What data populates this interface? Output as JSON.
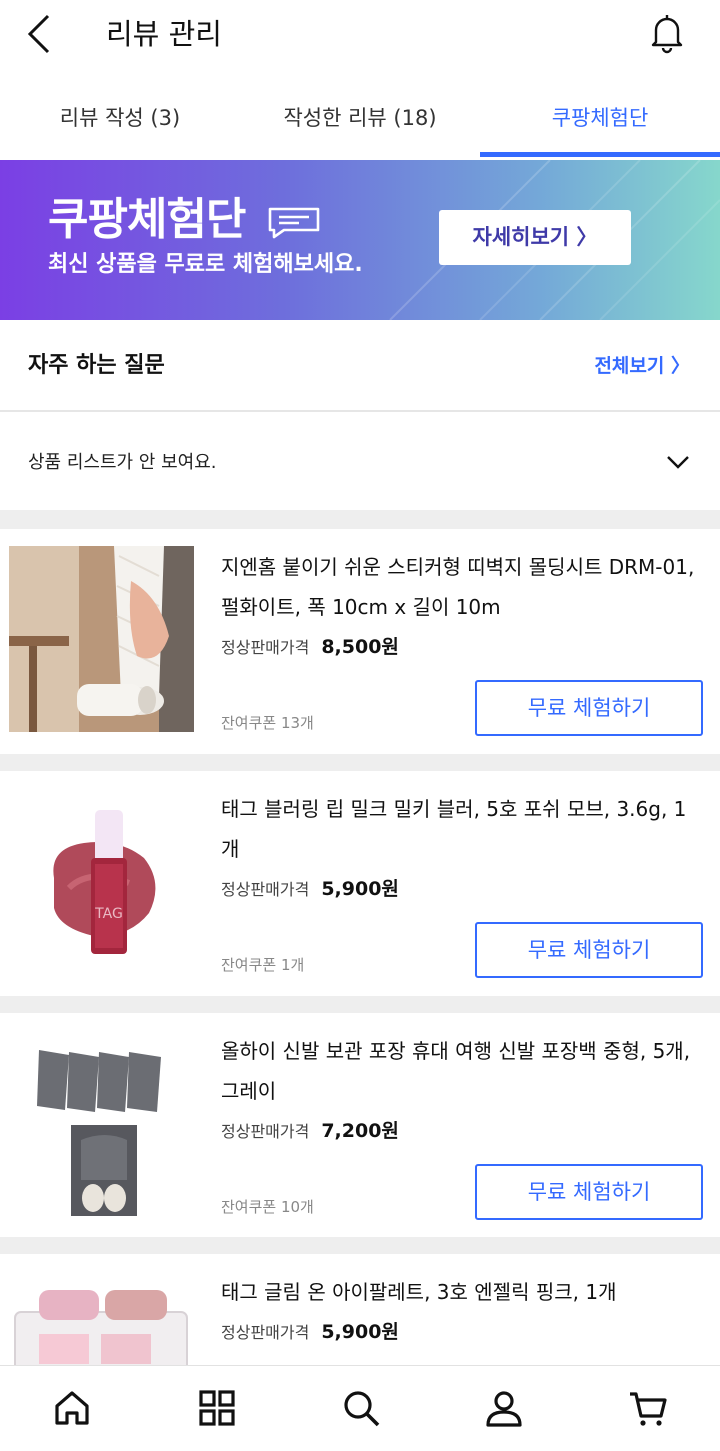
{
  "header": {
    "title": "리뷰 관리"
  },
  "tabs": [
    {
      "label": "리뷰 작성 (3)"
    },
    {
      "label": "작성한 리뷰 (18)"
    },
    {
      "label": "쿠팡체험단"
    }
  ],
  "banner": {
    "title": "쿠팡체험단",
    "subtitle": "최신 상품을 무료로 체험해보세요.",
    "button_label": "자세히보기 〉"
  },
  "faq": {
    "title": "자주 하는 질문",
    "view_all": "전체보기 〉",
    "items": [
      {
        "question": "상품 리스트가 안 보여요."
      }
    ]
  },
  "products": [
    {
      "name": "지엔홈 붙이기 쉬운 스티커형 띠벽지 몰딩시트 DRM-01, 펄화이트, 폭 10cm x 길이 10m",
      "price_label": "정상판매가격",
      "price": "8,500원",
      "coupon": "잔여쿠폰 13개",
      "button": "무료 체험하기"
    },
    {
      "name": "태그 블러링 립 밀크 밀키 블러, 5호 포쉬 모브, 3.6g, 1개",
      "price_label": "정상판매가격",
      "price": "5,900원",
      "coupon": "잔여쿠폰 1개",
      "button": "무료 체험하기"
    },
    {
      "name": "올하이 신발 보관 포장 휴대 여행 신발 포장백 중형, 5개, 그레이",
      "price_label": "정상판매가격",
      "price": "7,200원",
      "coupon": "잔여쿠폰 10개",
      "button": "무료 체험하기"
    },
    {
      "name": "태그 글림 온 아이팔레트, 3호 엔젤릭 핑크, 1개",
      "price_label": "정상판매가격",
      "price": "5,900원"
    }
  ],
  "bottom_nav": [
    {
      "icon": "home-icon"
    },
    {
      "icon": "category-grid-icon"
    },
    {
      "icon": "search-icon"
    },
    {
      "icon": "user-icon"
    },
    {
      "icon": "cart-icon"
    }
  ],
  "colors": {
    "accent": "#346aff",
    "banner_start": "#7b3fe4",
    "banner_end": "#86d7cc"
  }
}
